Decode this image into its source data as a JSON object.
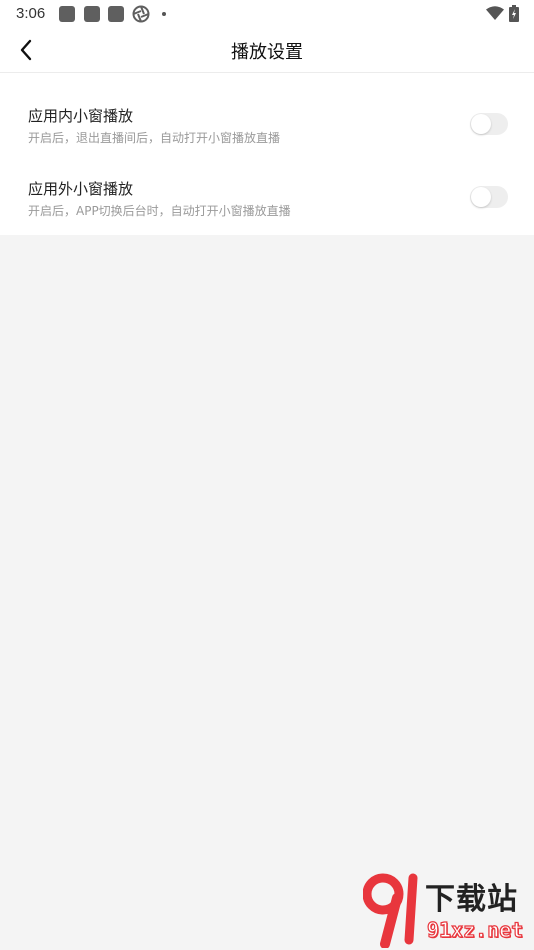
{
  "status_bar": {
    "time": "3:06"
  },
  "header": {
    "title": "播放设置"
  },
  "settings": [
    {
      "title": "应用内小窗播放",
      "description": "开启后，退出直播间后，自动打开小窗播放直播",
      "enabled": false
    },
    {
      "title": "应用外小窗播放",
      "description": "开启后，APP切换后台时，自动打开小窗播放直播",
      "enabled": false
    }
  ],
  "watermark": {
    "title": "下载站",
    "domain": "91xz.net"
  },
  "colors": {
    "background": "#f4f4f4",
    "card": "#ffffff",
    "toggle_off": "#eeeeee",
    "watermark_red": "#e8363d"
  }
}
